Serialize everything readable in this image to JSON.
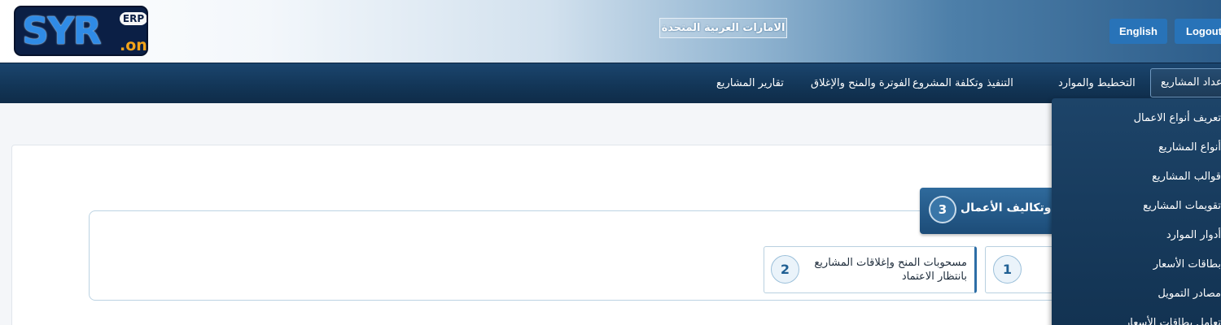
{
  "header": {
    "logo": {
      "main": "SYR",
      "badge": "ERP",
      "suffix": ".one"
    },
    "country_label": "الامارات العربية المتحدة",
    "english_button": "English",
    "logout_button": "Logout"
  },
  "nav": {
    "items": [
      {
        "label": "إعداد المشاريع"
      },
      {
        "label": "التخطيط والموارد"
      },
      {
        "label": "التنفيذ وتكلفة المشروع"
      },
      {
        "label": "الفوترة والمنح والإغلاق"
      },
      {
        "label": "تقارير المشاريع"
      }
    ]
  },
  "dropdown": {
    "items": [
      "تعريف أنواع الاعمال",
      "أنواع المشاريع",
      "قوالب المشاريع",
      "تقويمات المشاريع",
      "أدوار الموارد",
      "بطاقات الأسعار",
      "مصادر التمويل",
      "تعامل بطاقات الأسعار"
    ]
  },
  "steps": {
    "step1": {
      "number": "1"
    },
    "step2": {
      "number": "2",
      "text": "مسحوبات المنح وإغلاقات المشاريع بانتظار الاعتماد"
    },
    "step3": {
      "number": "3",
      "label": "وتكاليف الأعمال"
    }
  },
  "colors": {
    "nav_bg": "#123556",
    "accent_button": "#2873b8",
    "step_tab": "#1c4c78"
  }
}
